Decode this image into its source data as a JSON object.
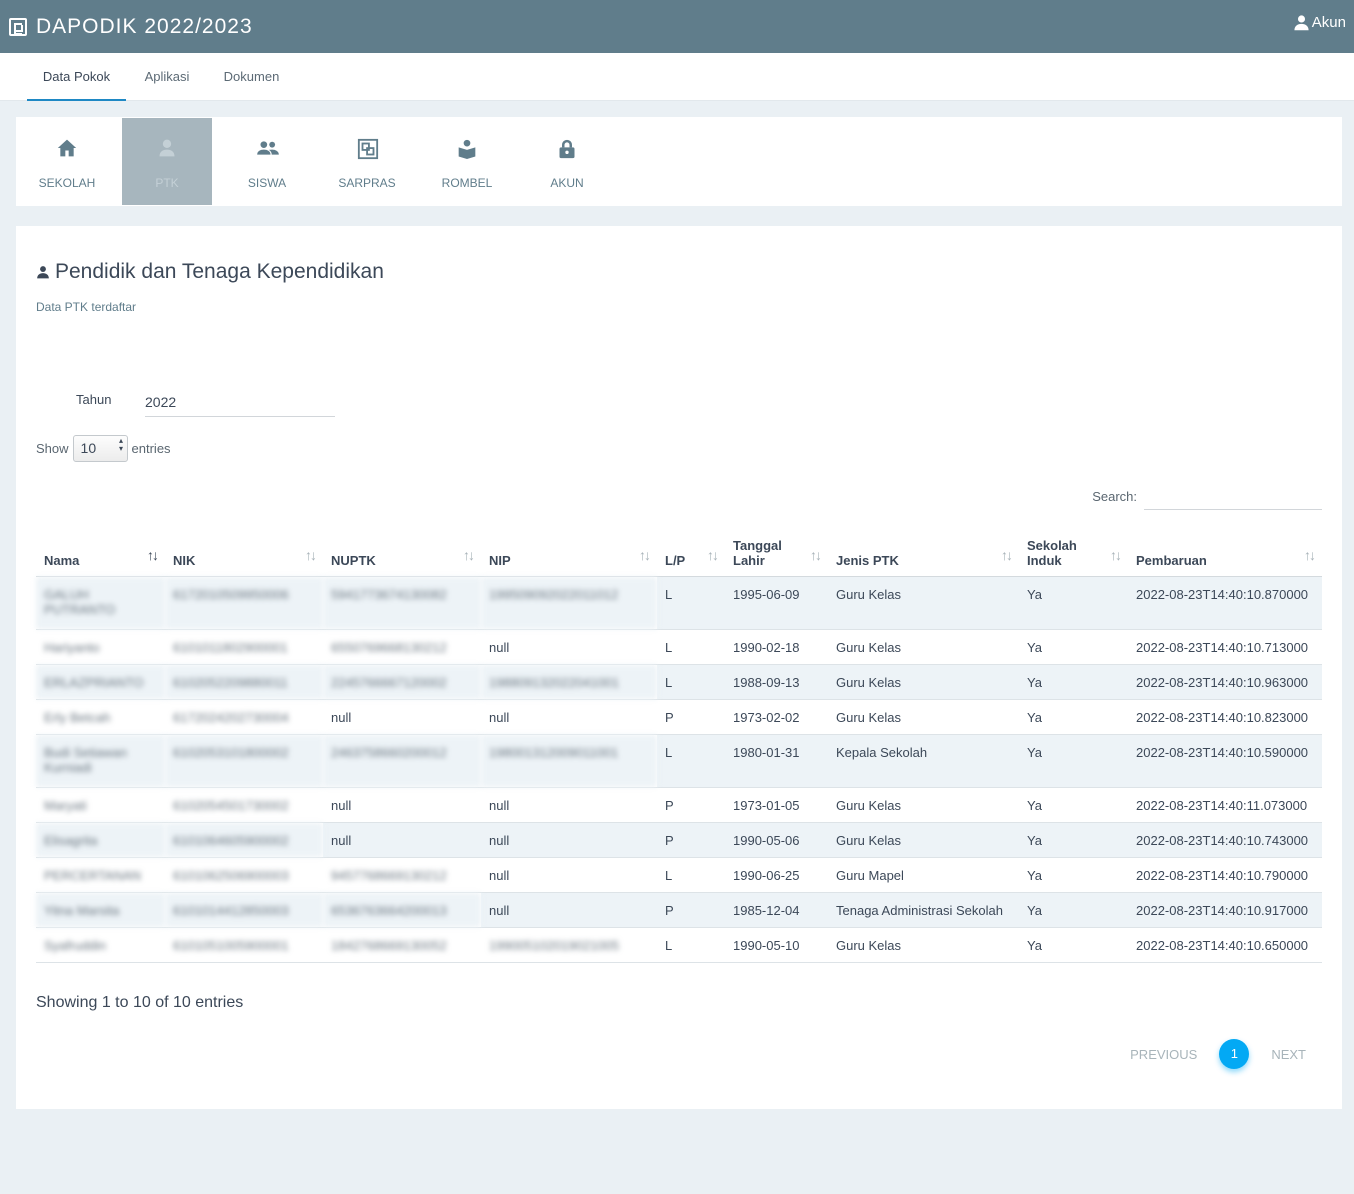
{
  "app": {
    "title": "DAPODIK 2022/2023",
    "account_label": "Akun"
  },
  "tabs": [
    {
      "label": "Data Pokok"
    },
    {
      "label": "Aplikasi"
    },
    {
      "label": "Dokumen"
    }
  ],
  "modules": [
    {
      "label": "SEKOLAH",
      "icon": "home-icon"
    },
    {
      "label": "PTK",
      "icon": "person-icon"
    },
    {
      "label": "SISWA",
      "icon": "people-icon"
    },
    {
      "label": "SARPRAS",
      "icon": "building-icon"
    },
    {
      "label": "ROMBEL",
      "icon": "reader-icon"
    },
    {
      "label": "AKUN",
      "icon": "lock-icon"
    }
  ],
  "section": {
    "title": "Pendidik dan Tenaga Kependidikan",
    "subtitle": "Data PTK terdaftar"
  },
  "filters": {
    "year_label": "Tahun",
    "year_value": "2022",
    "show_label": "Show",
    "show_value": "10",
    "entries_label": "entries",
    "search_label": "Search:"
  },
  "table": {
    "headers": [
      "Nama",
      "NIK",
      "NUPTK",
      "NIP",
      "L/P",
      "Tanggal Lahir",
      "Jenis PTK",
      "Sekolah Induk",
      "Pembaruan"
    ],
    "rows": [
      [
        "GALUH PUTRANTO",
        "6172010509950006",
        "5941773674130082",
        "199509092022011012",
        "L",
        "1995-06-09",
        "Guru Kelas",
        "Ya",
        "2022-08-23T14:40:10.870000"
      ],
      [
        "Hariyanto",
        "6101011802900001",
        "6550769668130212",
        "null",
        "L",
        "1990-02-18",
        "Guru Kelas",
        "Ya",
        "2022-08-23T14:40:10.713000"
      ],
      [
        "ERLAZPRIANTO",
        "6102052209880011",
        "2245766667120002",
        "198809132022041001",
        "L",
        "1988-09-13",
        "Guru Kelas",
        "Ya",
        "2022-08-23T14:40:10.963000"
      ],
      [
        "Erly Betcah",
        "6172024202730004",
        "null",
        "null",
        "P",
        "1973-02-02",
        "Guru Kelas",
        "Ya",
        "2022-08-23T14:40:10.823000"
      ],
      [
        "Budi Setiawan Kurniadi",
        "6102053101800002",
        "2463758660200012",
        "198001312009011001",
        "L",
        "1980-01-31",
        "Kepala Sekolah",
        "Ya",
        "2022-08-23T14:40:10.590000"
      ],
      [
        "Maryati",
        "6102054501730002",
        "null",
        "null",
        "P",
        "1973-01-05",
        "Guru Kelas",
        "Ya",
        "2022-08-23T14:40:11.073000"
      ],
      [
        "Elisagrita",
        "6101064605900002",
        "null",
        "null",
        "P",
        "1990-05-06",
        "Guru Kelas",
        "Ya",
        "2022-08-23T14:40:10.743000"
      ],
      [
        "PERCERTANAN",
        "6101062506900003",
        "9457768669130212",
        "null",
        "L",
        "1990-06-25",
        "Guru Mapel",
        "Ya",
        "2022-08-23T14:40:10.790000"
      ],
      [
        "Yitna Marsita",
        "6101014412850003",
        "6536763664200013",
        "null",
        "P",
        "1985-12-04",
        "Tenaga Administrasi Sekolah",
        "Ya",
        "2022-08-23T14:40:10.917000"
      ],
      [
        "Syafruddin",
        "6101051005900001",
        "1842768669130052",
        "199005102019021005",
        "L",
        "1990-05-10",
        "Guru Kelas",
        "Ya",
        "2022-08-23T14:40:10.650000"
      ]
    ]
  },
  "footer": {
    "info": "Showing 1 to 10 of 10 entries",
    "previous": "PREVIOUS",
    "page": "1",
    "next": "NEXT"
  },
  "colors": {
    "header_bg": "#607d8b",
    "accent": "#03a9f4",
    "tab_underline": "#1e88c4",
    "stripe": "#edf3f7",
    "module_active_bg": "#a7b6be"
  }
}
